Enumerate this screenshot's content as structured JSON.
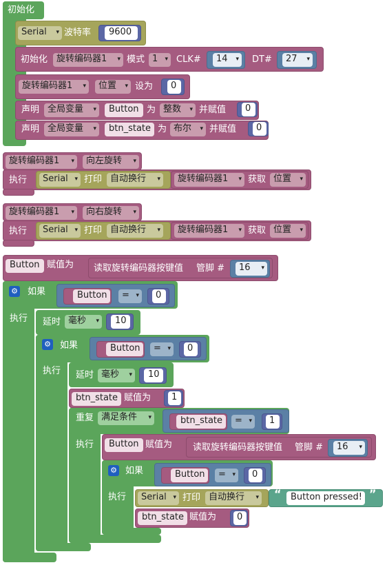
{
  "setup": {
    "title": "初始化",
    "serial": "Serial",
    "baud_label": "波特率",
    "baud_value": "9600",
    "init_label": "初始化",
    "encoder_name": "旋转编码器1",
    "mode_label": "模式",
    "mode_value": "1",
    "clk_label": "CLK#",
    "clk_value": "14",
    "dt_label": "DT#",
    "dt_value": "27",
    "pos_label": "位置",
    "set_label": "设为",
    "pos_value": "0",
    "declare_label": "声明",
    "global_label": "全局变量",
    "var1_name": "Button",
    "as_label": "为",
    "type1": "整数",
    "assign_label": "并赋值",
    "var1_init": "0",
    "var2_name": "btn_state",
    "type2": "布尔",
    "var2_init": "0"
  },
  "left_handler": {
    "encoder_name": "旋转编码器1",
    "direction": "向左旋转",
    "exec_label": "执行",
    "serial": "Serial",
    "print_label": "打印",
    "print_mode": "自动换行",
    "get_label": "获取",
    "get_value": "位置"
  },
  "right_handler": {
    "encoder_name": "旋转编码器1",
    "direction": "向右旋转",
    "exec_label": "执行",
    "serial": "Serial",
    "print_label": "打印",
    "print_mode": "自动换行",
    "get_label": "获取",
    "get_value": "位置"
  },
  "main": {
    "button_var": "Button",
    "assign_label": "赋值为",
    "read_label": "读取旋转编码器按键值",
    "pin_label": "管脚 #",
    "pin_value": "16",
    "if_label": "如果",
    "exec_label": "执行",
    "eq_op": "=",
    "zero": "0",
    "delay_label": "延时",
    "ms_label": "毫秒",
    "delay_value": "10",
    "state_var": "btn_state",
    "one": "1",
    "repeat_label": "重复",
    "until_label": "满足条件",
    "serial": "Serial",
    "print_label": "打印",
    "print_mode": "自动换行",
    "message": "Button pressed!"
  },
  "colors": {
    "control": "#5ba55b",
    "serial": "#a5a55b",
    "variable": "#a55b80",
    "logic": "#5b80a5",
    "number": "#5b67a5",
    "text": "#5ba58c"
  },
  "icons": {
    "gear": "gear-icon",
    "dropdown": "chevron-down-icon"
  }
}
